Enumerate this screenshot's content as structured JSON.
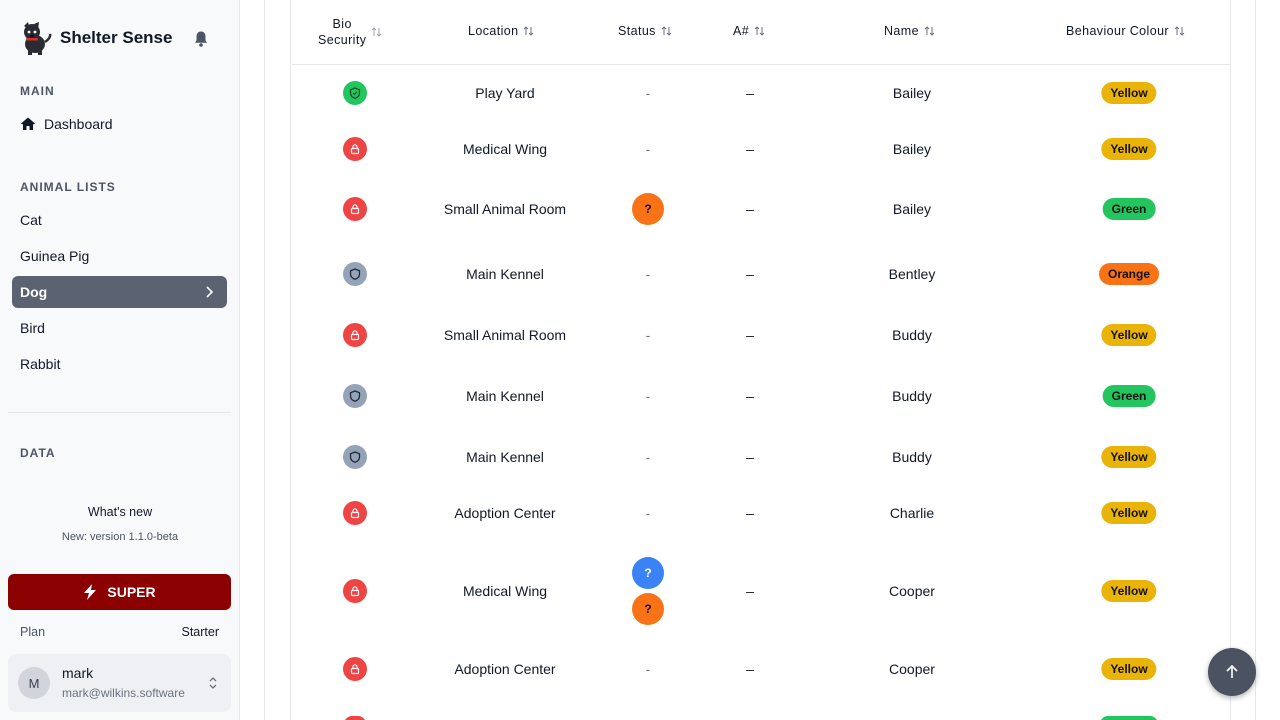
{
  "app": {
    "name": "Shelter Sense"
  },
  "sidebar": {
    "main_label": "MAIN",
    "dashboard": "Dashboard",
    "animal_lists_label": "ANIMAL LISTS",
    "animal_lists": [
      "Cat",
      "Guinea Pig",
      "Dog",
      "Bird",
      "Rabbit"
    ],
    "active_list": "Dog",
    "data_label": "DATA",
    "whats_new_title": "What's new",
    "whats_new_sub": "New: version 1.1.0-beta",
    "super_label": "SUPER",
    "plan_label": "Plan",
    "plan_value": "Starter",
    "user": {
      "initial": "M",
      "name": "mark",
      "email": "mark@wilkins.software"
    }
  },
  "table": {
    "headers": {
      "bio_line1": "Bio",
      "bio_line2": "Security",
      "location": "Location",
      "status": "Status",
      "anum": "A#",
      "name": "Name",
      "behaviour": "Behaviour Colour"
    },
    "rows": [
      {
        "bio": "green",
        "location": "Play Yard",
        "status": "-",
        "anum": "–",
        "name": "Bailey",
        "behaviour": "Yellow"
      },
      {
        "bio": "red",
        "location": "Medical Wing",
        "status": "-",
        "anum": "–",
        "name": "Bailey",
        "behaviour": "Yellow"
      },
      {
        "bio": "red",
        "location": "Small Animal Room",
        "status": "?",
        "anum": "–",
        "name": "Bailey",
        "behaviour": "Green"
      },
      {
        "bio": "gray",
        "location": "Main Kennel",
        "status": "-",
        "anum": "–",
        "name": "Bentley",
        "behaviour": "Orange"
      },
      {
        "bio": "red",
        "location": "Small Animal Room",
        "status": "-",
        "anum": "–",
        "name": "Buddy",
        "behaviour": "Yellow"
      },
      {
        "bio": "gray",
        "location": "Main Kennel",
        "status": "-",
        "anum": "–",
        "name": "Buddy",
        "behaviour": "Green"
      },
      {
        "bio": "gray",
        "location": "Main Kennel",
        "status": "-",
        "anum": "–",
        "name": "Buddy",
        "behaviour": "Yellow"
      },
      {
        "bio": "red",
        "location": "Adoption Center",
        "status": "-",
        "anum": "–",
        "name": "Charlie",
        "behaviour": "Yellow"
      },
      {
        "bio": "red",
        "location": "Medical Wing",
        "status_top": "?",
        "status_bottom": "?",
        "anum": "–",
        "name": "Cooper",
        "behaviour": "Yellow"
      },
      {
        "bio": "red",
        "location": "Adoption Center",
        "status": "-",
        "anum": "–",
        "name": "Cooper",
        "behaviour": "Yellow"
      }
    ]
  },
  "colors": {
    "sidebar_bg": "#f8f9fb",
    "active_nav": "#5b6271",
    "super_btn": "#8b0000",
    "bio_green": "#22c55e",
    "bio_red": "#ef4444",
    "bio_gray": "#94a3b8",
    "badge_yellow": "#eab308",
    "badge_green": "#22c55e",
    "badge_orange": "#f97316",
    "status_orange": "#f97316",
    "status_blue": "#3b82f6"
  }
}
